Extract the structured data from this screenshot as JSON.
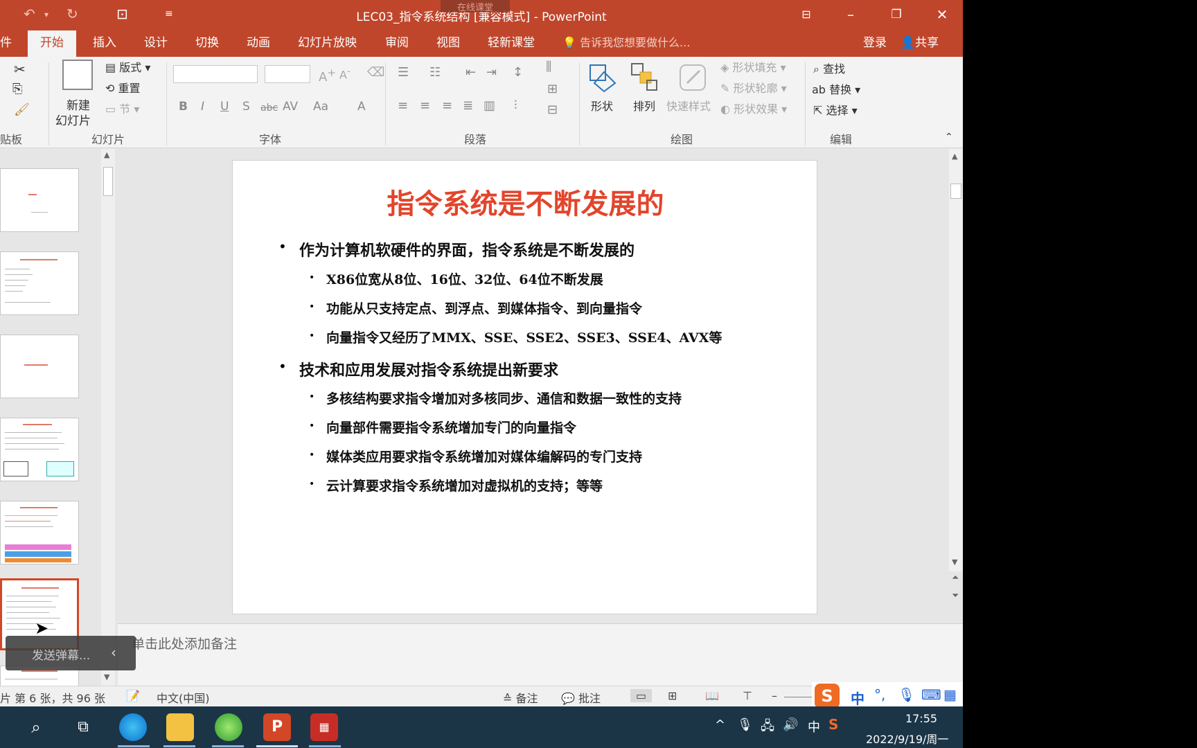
{
  "window": {
    "title": "LEC03_指令系统结构 [兼容模式] - PowerPoint",
    "overlay_badge": "在线课堂"
  },
  "tabs": [
    "件",
    "开始",
    "插入",
    "设计",
    "切换",
    "动画",
    "幻灯片放映",
    "审阅",
    "视图",
    "轻新课堂"
  ],
  "tell_me": "告诉我您想要做什么...",
  "account": {
    "login": "登录",
    "share": "共享"
  },
  "ribbon": {
    "clipboard_label": "贴板",
    "slides": {
      "new_slide": "新建",
      "new_slide2": "幻灯片",
      "layout": "版式",
      "reset": "重置",
      "section": "节",
      "label": "幻灯片"
    },
    "font": {
      "label": "字体",
      "bold": "B",
      "italic": "I",
      "underline": "U",
      "shadow": "S",
      "strike": "abc",
      "spacing": "AV",
      "case": "Aa",
      "color": "A"
    },
    "paragraph": {
      "label": "段落"
    },
    "drawing": {
      "shape": "形状",
      "arrange": "排列",
      "quick_styles": "快速样式",
      "fill": "形状填充",
      "outline": "形状轮廓",
      "effects": "形状效果",
      "label": "绘图"
    },
    "editing": {
      "find": "查找",
      "replace": "替换",
      "select": "选择",
      "label": "编辑"
    }
  },
  "slide": {
    "title": "指令系统是不断发展的",
    "bullets": [
      {
        "level": 1,
        "text": "作为计算机软硬件的界面，指令系统是不断发展的"
      },
      {
        "level": 2,
        "text": "X86位宽从8位、16位、32位、64位不断发展"
      },
      {
        "level": 2,
        "text": "功能从只支持定点、到浮点、到媒体指令、到向量指令"
      },
      {
        "level": 2,
        "text": "向量指令又经历了MMX、SSE、SSE2、SSE3、SSE4、AVX等"
      },
      {
        "level": 1,
        "text": "技术和应用发展对指令系统提出新要求"
      },
      {
        "level": 2,
        "text": "多核结构要求指令增加对多核同步、通信和数据一致性的支持"
      },
      {
        "level": 2,
        "text": "向量部件需要指令系统增加专门的向量指令"
      },
      {
        "level": 2,
        "text": "媒体类应用要求指令系统增加对媒体编解码的专门支持"
      },
      {
        "level": 2,
        "text": "云计算要求指令系统增加对虚拟机的支持；等等"
      }
    ]
  },
  "notes_placeholder": "单击此处添加备注",
  "danmaku": "发送弹幕...",
  "status": {
    "slide_info": "片 第 6 张，共 96 张",
    "language": "中文(中国)",
    "notes": "备注",
    "comments": "批注"
  },
  "clock": {
    "time": "17:55",
    "date": "2022/9/19/周一"
  },
  "ime": {
    "lang": "中"
  },
  "colors": {
    "accent": "#c0462b",
    "title_red": "#e2452b"
  }
}
